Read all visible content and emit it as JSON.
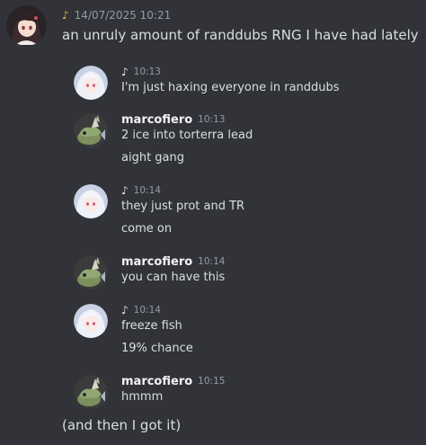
{
  "post": {
    "timestamp": "14/07/2025 10:21",
    "text": "an unruly amount of randdubs RNG I have had lately",
    "closing_text": "(and then I got it)"
  },
  "messages": [
    {
      "kind": "self",
      "username": "",
      "time": "10:13",
      "lines": [
        "I'm just haxing everyone in randdubs"
      ]
    },
    {
      "kind": "other",
      "username": "marcofiero",
      "time": "10:13",
      "lines": [
        "2 ice into torterra lead",
        "aight gang"
      ]
    },
    {
      "kind": "self",
      "username": "",
      "time": "10:14",
      "lines": [
        "they just prot and TR",
        "come on"
      ]
    },
    {
      "kind": "other",
      "username": "marcofiero",
      "time": "10:14",
      "lines": [
        "you can have this"
      ]
    },
    {
      "kind": "self",
      "username": "",
      "time": "10:14",
      "lines": [
        "freeze fish",
        "19% chance"
      ]
    },
    {
      "kind": "other",
      "username": "marcofiero",
      "time": "10:15",
      "lines": [
        "hmmm"
      ]
    }
  ],
  "icons": {
    "role_note": "music-note-icon",
    "outer_avatar": "anime-girl-avatar",
    "self_avatar": "white-haired-avatar",
    "other_avatar": "pokemon-avatar"
  },
  "colors": {
    "background": "#313338",
    "text": "#dbdee1",
    "muted": "#949ba4",
    "note_accent": "#f0b232",
    "username": "#f2f3f5"
  }
}
